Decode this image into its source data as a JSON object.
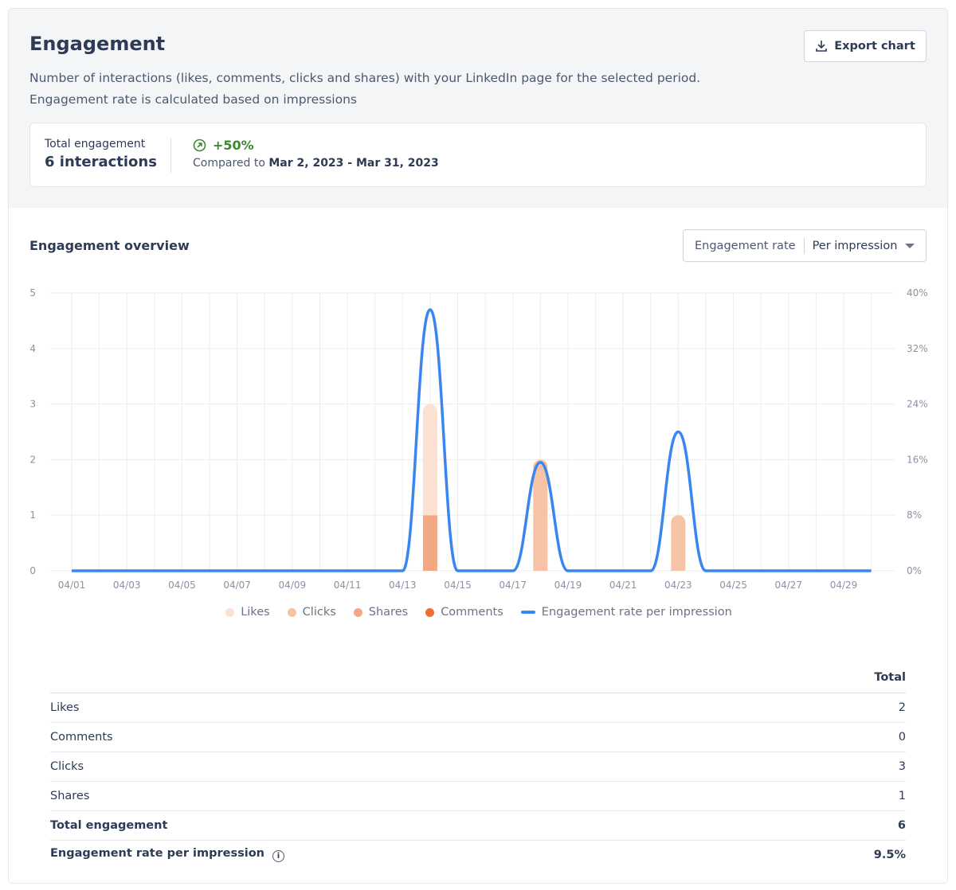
{
  "header": {
    "title": "Engagement",
    "description_line1": "Number of interactions (likes, comments, clicks and shares) with your LinkedIn page for the selected period.",
    "description_line2": "Engagement rate is calculated based on impressions",
    "export_label": "Export chart"
  },
  "summary": {
    "label": "Total engagement",
    "value": "6 interactions",
    "change": "+50%",
    "compared_prefix": "Compared to",
    "compared_range": "Mar 2, 2023 - Mar 31, 2023"
  },
  "overview": {
    "title": "Engagement overview",
    "dropdown_label": "Engagement rate",
    "dropdown_value": "Per impression"
  },
  "chart_data": {
    "type": "bar+line",
    "x": [
      "04/01",
      "04/02",
      "04/03",
      "04/04",
      "04/05",
      "04/06",
      "04/07",
      "04/08",
      "04/09",
      "04/10",
      "04/11",
      "04/12",
      "04/13",
      "04/14",
      "04/15",
      "04/16",
      "04/17",
      "04/18",
      "04/19",
      "04/20",
      "04/21",
      "04/22",
      "04/23",
      "04/24",
      "04/25",
      "04/26",
      "04/27",
      "04/28",
      "04/29",
      "04/30"
    ],
    "x_tick_labels": [
      "04/01",
      "04/03",
      "04/05",
      "04/07",
      "04/09",
      "04/11",
      "04/13",
      "04/15",
      "04/17",
      "04/19",
      "04/21",
      "04/23",
      "04/25",
      "04/27",
      "04/29"
    ],
    "ylim": [
      0,
      5
    ],
    "y_ticks": [
      "0",
      "1",
      "2",
      "3",
      "4",
      "5"
    ],
    "y2lim": [
      0,
      40
    ],
    "y2_ticks": [
      "0%",
      "8%",
      "16%",
      "24%",
      "32%",
      "40%"
    ],
    "grid": true,
    "legend": "bottom",
    "series": [
      {
        "name": "Likes",
        "kind": "bar",
        "color": "#fbe0d3",
        "values": {
          "04/14": 2
        }
      },
      {
        "name": "Clicks",
        "kind": "bar",
        "color": "#f7c3a6",
        "values": {
          "04/18": 2,
          "04/23": 1
        }
      },
      {
        "name": "Shares",
        "kind": "bar",
        "color": "#f2a882",
        "values": {
          "04/14": 1
        }
      },
      {
        "name": "Comments",
        "kind": "bar",
        "color": "#ef6c35",
        "values": {}
      },
      {
        "name": "Engagement rate per impression",
        "kind": "line",
        "axis": "right",
        "color": "#3a86f0",
        "values": {
          "04/14": 37.6,
          "04/18": 15.6,
          "04/23": 20
        }
      }
    ]
  },
  "table": {
    "header": "Total",
    "rows": [
      {
        "label": "Likes",
        "value": "2"
      },
      {
        "label": "Comments",
        "value": "0"
      },
      {
        "label": "Clicks",
        "value": "3"
      },
      {
        "label": "Shares",
        "value": "1"
      },
      {
        "label": "Total engagement",
        "value": "6",
        "bold": true
      },
      {
        "label": "Engagement rate per impression",
        "value": "9.5%",
        "bold": true,
        "info_icon": true
      }
    ]
  }
}
